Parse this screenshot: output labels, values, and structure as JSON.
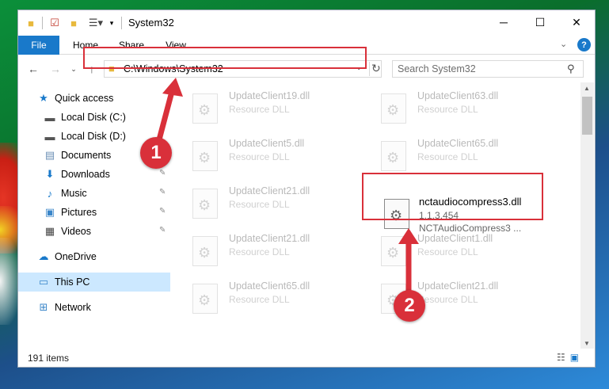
{
  "window": {
    "title": "System32",
    "controls": {
      "minimize": "─",
      "maximize": "☐",
      "close": "✕"
    }
  },
  "quick_access_toolbar": {
    "folder_icon": "folder-icon",
    "properties_icon": "properties-icon",
    "new_folder_icon": "new-folder-icon",
    "view_icon": "view-icon",
    "dropdown": "▾"
  },
  "ribbon": {
    "tabs": [
      "File",
      "Home",
      "Share",
      "View"
    ],
    "expand_glyph": "⌄",
    "help_glyph": "?"
  },
  "nav": {
    "back": "←",
    "forward": "→",
    "recent": "⌄",
    "up": "↑",
    "address": "C:\\Windows\\System32",
    "address_dropdown": "⌄",
    "refresh": "↻",
    "search_placeholder": "Search System32"
  },
  "sidebar": {
    "items": [
      {
        "label": "Quick access",
        "icon": "star-icon",
        "glyph": "★",
        "color": "#1979ca",
        "pinned": false
      },
      {
        "label": "Local Disk (C:)",
        "icon": "drive-icon",
        "glyph": "▬",
        "color": "#555555",
        "pinned": false
      },
      {
        "label": "Local Disk (D:)",
        "icon": "drive-icon",
        "glyph": "▬",
        "color": "#555555",
        "pinned": false
      },
      {
        "label": "Documents",
        "icon": "documents-icon",
        "glyph": "▤",
        "color": "#6b8fb5",
        "pinned": true
      },
      {
        "label": "Downloads",
        "icon": "download-icon",
        "glyph": "⬇",
        "color": "#1979ca",
        "pinned": true
      },
      {
        "label": "Music",
        "icon": "music-icon",
        "glyph": "♪",
        "color": "#1979ca",
        "pinned": true
      },
      {
        "label": "Pictures",
        "icon": "pictures-icon",
        "glyph": "▣",
        "color": "#3a86c9",
        "pinned": true
      },
      {
        "label": "Videos",
        "icon": "videos-icon",
        "glyph": "▦",
        "color": "#444444",
        "pinned": true
      },
      {
        "label": "OneDrive",
        "icon": "cloud-icon",
        "glyph": "☁",
        "color": "#1979ca",
        "pinned": false
      },
      {
        "label": "This PC",
        "icon": "computer-icon",
        "glyph": "▭",
        "color": "#3a86c9",
        "pinned": false,
        "selected": true
      },
      {
        "label": "Network",
        "icon": "network-icon",
        "glyph": "⊞",
        "color": "#3a86c9",
        "pinned": false
      }
    ],
    "pin_glyph": "📌"
  },
  "files": [
    {
      "name": "UpdateClient19.dll",
      "type": "Resource DLL"
    },
    {
      "name": "UpdateClient63.dll",
      "type": "Resource DLL"
    },
    {
      "name": "UpdateClient5.dll",
      "type": "Resource DLL"
    },
    {
      "name": "UpdateClient65.dll",
      "type": "Resource DLL"
    },
    {
      "name": "UpdateClient21.dll",
      "type": "Resource DLL"
    },
    {
      "name": "UpdateClient21.dll",
      "type": "Resource DLL"
    },
    {
      "name": "UpdateClient1.dll",
      "type": "Resource DLL"
    },
    {
      "name": "UpdateClient65.dll",
      "type": "Resource DLL"
    },
    {
      "name": "UpdateClient21.dll",
      "type": "Resource DLL"
    }
  ],
  "focused_file": {
    "name": "nctaudiocompress3.dll",
    "version": "1.1.3.454",
    "description": "NCTAudioCompress3    ..."
  },
  "status": {
    "item_count": "191 items"
  },
  "callouts": {
    "badge_1": "1",
    "badge_2": "2",
    "color": "#d9303a"
  },
  "colors": {
    "accent": "#1979ca",
    "selection": "#cce8ff",
    "highlight": "#d9303a"
  }
}
